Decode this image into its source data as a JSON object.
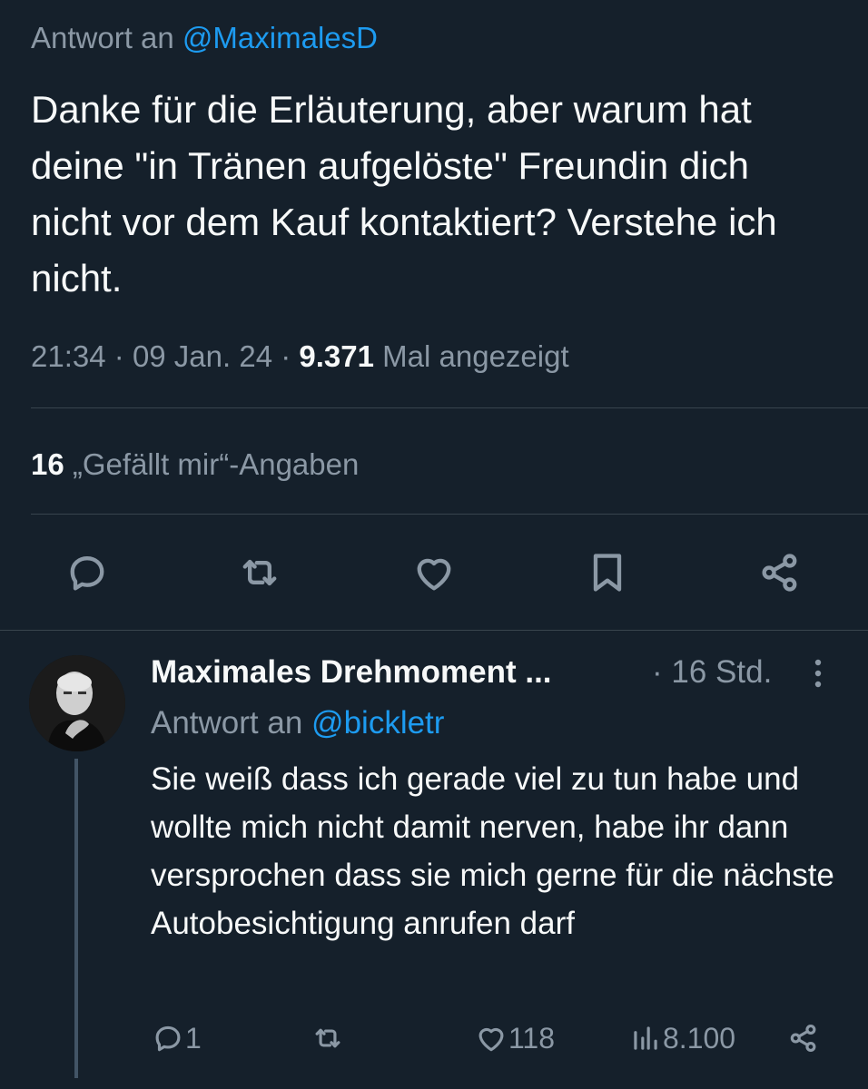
{
  "main_tweet": {
    "reply_prefix": "Antwort an",
    "reply_handle": "@MaximalesD",
    "text": "Danke für die Erläuterung, aber warum hat deine \"in Tränen aufgelöste\" Freundin dich nicht vor dem Kauf kontaktiert? Verstehe ich nicht.",
    "time": "21:34",
    "sep": "·",
    "date": "09 Jan. 24",
    "views_count": "9.371",
    "views_label": "Mal angezeigt",
    "likes_count": "16",
    "likes_label": "„Gefällt mir“-Angaben",
    "actions": [
      "reply-icon",
      "retweet-icon",
      "like-icon",
      "bookmark-icon",
      "share-icon"
    ]
  },
  "reply_tweet": {
    "author_name": "Maximales Drehmoment ...",
    "time": "· 16 Std.",
    "reply_prefix": "Antwort an",
    "reply_handle": "@bickletr",
    "text": "Sie weiß dass ich gerade viel zu tun habe und wollte mich nicht damit nerven, habe ihr dann versprochen dass sie mich gerne für die nächste Autobesichtigung anrufen darf",
    "replies": "1",
    "retweets": "",
    "likes": "118",
    "views": "8.100"
  },
  "colors": {
    "background": "#15202b",
    "text": "#f7f9f9",
    "muted": "#8b98a5",
    "accent": "#1d9bf0",
    "divider": "#38444d"
  }
}
